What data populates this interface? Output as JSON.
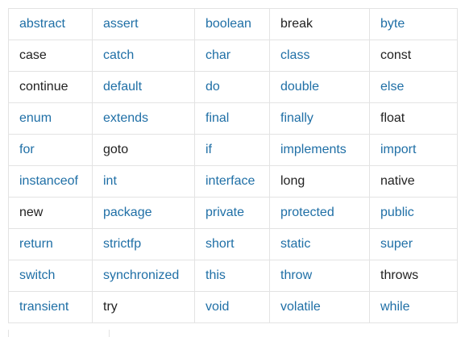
{
  "colors": {
    "link": "#1f6fa6",
    "text": "#222222",
    "border": "#e3e3e3"
  },
  "keywords": [
    [
      {
        "text": "abstract",
        "link": true
      },
      {
        "text": "assert",
        "link": true
      },
      {
        "text": "boolean",
        "link": true
      },
      {
        "text": "break",
        "link": false
      },
      {
        "text": "byte",
        "link": true
      }
    ],
    [
      {
        "text": "case",
        "link": false
      },
      {
        "text": "catch",
        "link": true
      },
      {
        "text": "char",
        "link": true
      },
      {
        "text": "class",
        "link": true
      },
      {
        "text": "const",
        "link": false
      }
    ],
    [
      {
        "text": "continue",
        "link": false
      },
      {
        "text": "default",
        "link": true
      },
      {
        "text": "do",
        "link": true
      },
      {
        "text": "double",
        "link": true
      },
      {
        "text": "else",
        "link": true
      }
    ],
    [
      {
        "text": "enum",
        "link": true
      },
      {
        "text": "extends",
        "link": true
      },
      {
        "text": "final",
        "link": true
      },
      {
        "text": "finally",
        "link": true
      },
      {
        "text": "float",
        "link": false
      }
    ],
    [
      {
        "text": "for",
        "link": true
      },
      {
        "text": "goto",
        "link": false
      },
      {
        "text": "if",
        "link": true
      },
      {
        "text": "implements",
        "link": true
      },
      {
        "text": "import",
        "link": true
      }
    ],
    [
      {
        "text": "instanceof",
        "link": true
      },
      {
        "text": "int",
        "link": true
      },
      {
        "text": "interface",
        "link": true
      },
      {
        "text": "long",
        "link": false
      },
      {
        "text": "native",
        "link": false
      }
    ],
    [
      {
        "text": "new",
        "link": false
      },
      {
        "text": "package",
        "link": true
      },
      {
        "text": "private",
        "link": true
      },
      {
        "text": "protected",
        "link": true
      },
      {
        "text": "public",
        "link": true
      }
    ],
    [
      {
        "text": "return",
        "link": true
      },
      {
        "text": "strictfp",
        "link": true
      },
      {
        "text": "short",
        "link": true
      },
      {
        "text": "static",
        "link": true
      },
      {
        "text": "super",
        "link": true
      }
    ],
    [
      {
        "text": "switch",
        "link": true
      },
      {
        "text": "synchronized",
        "link": true
      },
      {
        "text": "this",
        "link": true
      },
      {
        "text": "throw",
        "link": true
      },
      {
        "text": "throws",
        "link": false
      }
    ],
    [
      {
        "text": "transient",
        "link": true
      },
      {
        "text": "try",
        "link": false
      },
      {
        "text": "void",
        "link": true
      },
      {
        "text": "volatile",
        "link": true
      },
      {
        "text": "while",
        "link": true
      }
    ]
  ]
}
